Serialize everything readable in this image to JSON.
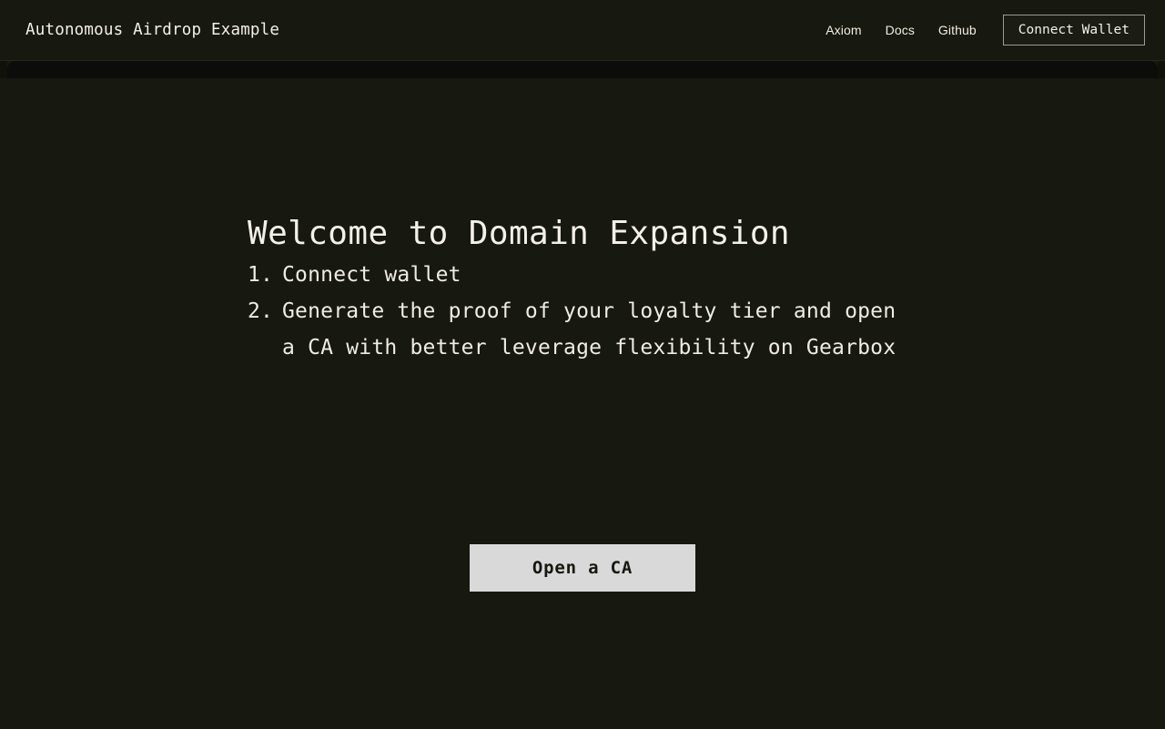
{
  "header": {
    "brand_title": "Autonomous Airdrop Example",
    "nav_links": [
      {
        "label": "Axiom",
        "name": "nav-link-axiom"
      },
      {
        "label": "Docs",
        "name": "nav-link-docs"
      },
      {
        "label": "Github",
        "name": "nav-link-github"
      }
    ],
    "connect_wallet_label": "Connect Wallet"
  },
  "main": {
    "heading": "Welcome to Domain Expansion",
    "steps": [
      {
        "marker": "1.",
        "text": "Connect wallet"
      },
      {
        "marker": "2.",
        "text": "Generate the proof of your loyalty tier and open a CA with better leverage flexibility on Gearbox"
      }
    ],
    "cta_label": "Open a CA"
  },
  "colors": {
    "page_background": "#17180f",
    "header_background": "#17180f",
    "header_border": "#26271d",
    "body_lip": "#0c0d0a",
    "text_primary": "#f3f0e7",
    "nav_text": "#f1ede1",
    "connect_border": "#9b9b93",
    "cta_background": "#d9d9d9",
    "cta_text": "#16170f"
  }
}
